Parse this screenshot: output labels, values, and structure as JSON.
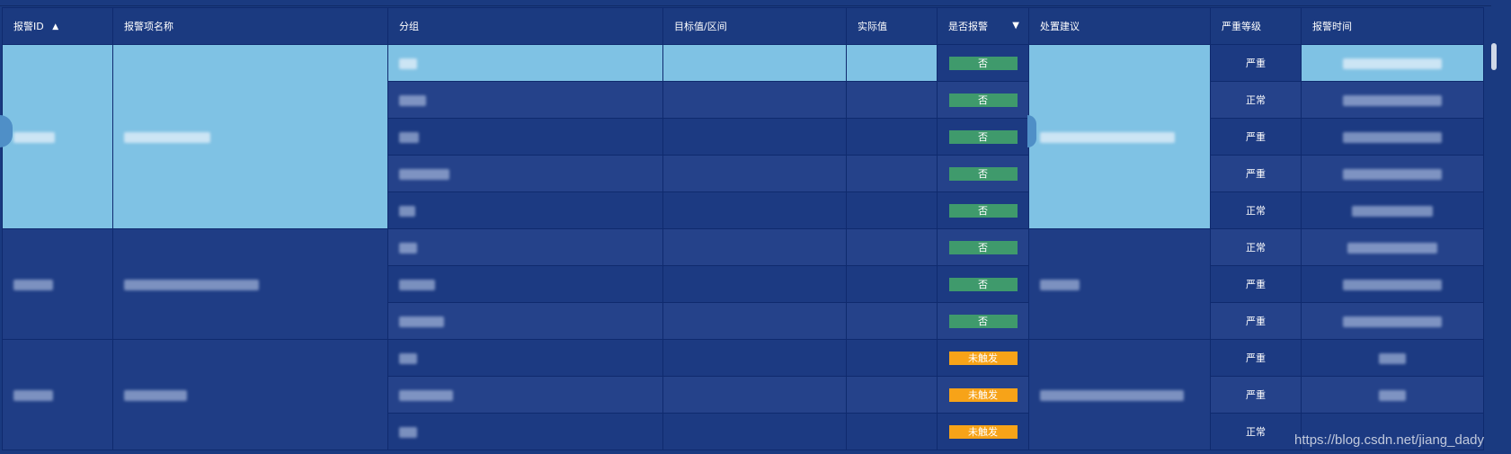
{
  "columns": [
    {
      "label": "报警ID"
    },
    {
      "label": "报警项名称"
    },
    {
      "label": "分组"
    },
    {
      "label": "目标值/区间"
    },
    {
      "label": "实际值"
    },
    {
      "label": "是否报警"
    },
    {
      "label": "处置建议"
    },
    {
      "label": "严重等级"
    },
    {
      "label": "报警时间"
    }
  ],
  "icons": {
    "sort": "sort-icon",
    "filter": "filter-icon"
  },
  "status_colors": {
    "no": "#3f9a6c",
    "untriggered": "#f7a318",
    "highlight": "#7fc2e4"
  },
  "rows": [
    {
      "alarm": "否",
      "severity": "严重"
    },
    {
      "alarm": "否",
      "severity": "正常"
    },
    {
      "alarm": "否",
      "severity": "严重"
    },
    {
      "alarm": "否",
      "severity": "严重"
    },
    {
      "alarm": "否",
      "severity": "正常"
    },
    {
      "alarm": "否",
      "severity": "正常"
    },
    {
      "alarm": "否",
      "severity": "严重"
    },
    {
      "alarm": "否",
      "severity": "严重"
    },
    {
      "alarm": "未触发",
      "severity": "严重"
    },
    {
      "alarm": "未触发",
      "severity": "严重"
    },
    {
      "alarm": "未触发",
      "severity": "正常"
    }
  ],
  "watermark": "https://blog.csdn.net/jiang_dady"
}
